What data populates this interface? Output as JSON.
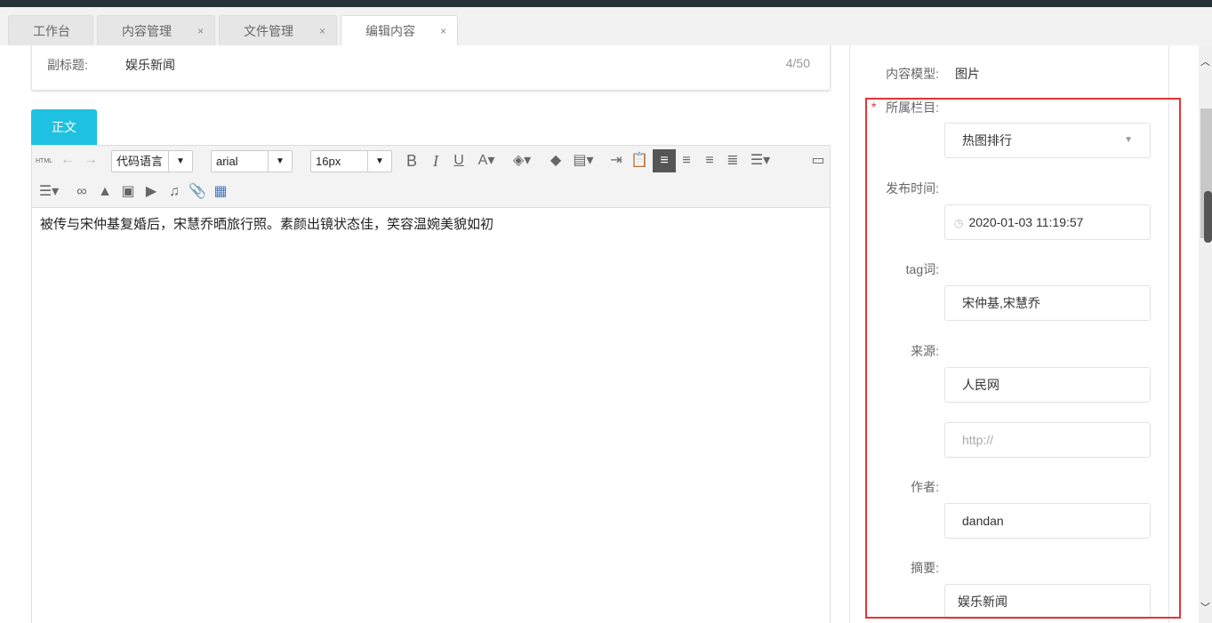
{
  "tabs": [
    {
      "label": "工作台",
      "closable": false
    },
    {
      "label": "内容管理",
      "closable": true
    },
    {
      "label": "文件管理",
      "closable": true
    },
    {
      "label": "编辑内容",
      "closable": true,
      "active": true
    }
  ],
  "close_glyph": "×",
  "subtitle": {
    "label": "副标题:",
    "value": "娱乐新闻",
    "count": "4/50"
  },
  "body_tab": "正文",
  "toolbar": {
    "html": "HTML",
    "code_lang": "代码语言",
    "font": "arial",
    "size": "16px"
  },
  "editor_content": "被传与宋仲基复婚后，宋慧乔晒旅行照。素颜出镜状态佳，笑容温婉美貌如初",
  "right": {
    "model_label": "内容模型:",
    "model_value": "图片",
    "required_mark": "*",
    "column_label": "所属栏目:",
    "column_value": "热图排行",
    "time_label": "发布时间:",
    "time_value": "2020-01-03 11:19:57",
    "tag_label": "tag词:",
    "tag_value": "宋仲基,宋慧乔",
    "source_label": "来源:",
    "source_value": "人民网",
    "source_url_placeholder": "http://",
    "author_label": "作者:",
    "author_value": "dandan",
    "summary_label": "摘要:",
    "summary_value": "娱乐新闻"
  },
  "colors": {
    "accent": "#1fc1e0",
    "highlight": "#e93434"
  }
}
